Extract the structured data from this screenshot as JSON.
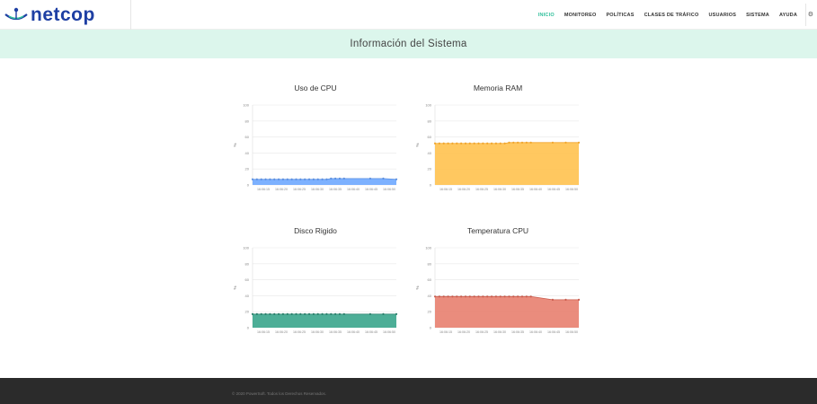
{
  "header": {
    "logo_text": "netcop",
    "nav": [
      {
        "label": "INICIO",
        "active": true
      },
      {
        "label": "MONITOREO",
        "active": false
      },
      {
        "label": "POLÍTICAS",
        "active": false
      },
      {
        "label": "CLASES DE TRÁFICO",
        "active": false
      },
      {
        "label": "USUARIOS",
        "active": false
      },
      {
        "label": "SISTEMA",
        "active": false
      },
      {
        "label": "AYUDA",
        "active": false
      }
    ],
    "settings_icon": "gear-icon"
  },
  "banner": {
    "title": "Información del Sistema"
  },
  "colors": {
    "accent": "#2fbf9b",
    "banner_bg": "#dcf6ec",
    "footer_bg": "#2b2b2b"
  },
  "chart_data": [
    {
      "type": "area",
      "title": "Uso de CPU",
      "ylabel": "%",
      "ylim": [
        0,
        100
      ],
      "yticks": [
        0,
        20,
        40,
        60,
        80,
        100
      ],
      "x_tick_labels": [
        "16:06:15",
        "16:06:20",
        "16:06:25",
        "16:06:30",
        "16:06:35",
        "16:06:40",
        "16:06:45",
        "16:06:50"
      ],
      "values": [
        7,
        7,
        7,
        7,
        7,
        7,
        7,
        7,
        7,
        7,
        7,
        7,
        7,
        7,
        7,
        7,
        7,
        7,
        8,
        8,
        8,
        8,
        null,
        null,
        null,
        null,
        null,
        8,
        null,
        null,
        8,
        null,
        null,
        7
      ],
      "color": "#6fa8ff",
      "line_color": "#5b8fe0"
    },
    {
      "type": "area",
      "title": "Memoria RAM",
      "ylabel": "%",
      "ylim": [
        0,
        100
      ],
      "yticks": [
        0,
        20,
        40,
        60,
        80,
        100
      ],
      "x_tick_labels": [
        "16:06:15",
        "16:06:20",
        "16:06:25",
        "16:06:30",
        "16:06:35",
        "16:06:40",
        "16:06:45",
        "16:06:50"
      ],
      "values": [
        52,
        52,
        52,
        52,
        52,
        52,
        52,
        52,
        52,
        52,
        52,
        52,
        52,
        52,
        52,
        52,
        52,
        53,
        53,
        53,
        53,
        53,
        53,
        null,
        null,
        null,
        null,
        53,
        null,
        null,
        53,
        null,
        null,
        53
      ],
      "color": "#ffc24f",
      "line_color": "#f0a52c"
    },
    {
      "type": "area",
      "title": "Disco Rigido",
      "ylabel": "%",
      "ylim": [
        0,
        100
      ],
      "yticks": [
        0,
        20,
        40,
        60,
        80,
        100
      ],
      "x_tick_labels": [
        "16:06:15",
        "16:06:20",
        "16:06:25",
        "16:06:30",
        "16:06:35",
        "16:06:40",
        "16:06:45",
        "16:06:50"
      ],
      "values": [
        17,
        17,
        17,
        17,
        17,
        17,
        17,
        17,
        17,
        17,
        17,
        17,
        17,
        17,
        17,
        17,
        17,
        17,
        17,
        17,
        17,
        17,
        null,
        null,
        null,
        null,
        null,
        17,
        null,
        null,
        17,
        null,
        null,
        17
      ],
      "color": "#3aa58c",
      "line_color": "#2a7f6b"
    },
    {
      "type": "area",
      "title": "Temperatura CPU",
      "ylabel": "%",
      "ylim": [
        0,
        100
      ],
      "yticks": [
        0,
        20,
        40,
        60,
        80,
        100
      ],
      "x_tick_labels": [
        "16:06:15",
        "16:06:20",
        "16:06:25",
        "16:06:30",
        "16:06:35",
        "16:06:40",
        "16:06:45",
        "16:06:50"
      ],
      "values": [
        39,
        39,
        39,
        39,
        39,
        39,
        39,
        39,
        39,
        39,
        39,
        39,
        39,
        39,
        39,
        39,
        39,
        39,
        39,
        39,
        39,
        39,
        39,
        null,
        null,
        null,
        null,
        35,
        null,
        null,
        35,
        null,
        null,
        35
      ],
      "color": "#e87f6f",
      "line_color": "#c95c4d"
    }
  ],
  "footer": {
    "text": "© 2020 PowerSoft. Todos los Derechos Reservados."
  }
}
